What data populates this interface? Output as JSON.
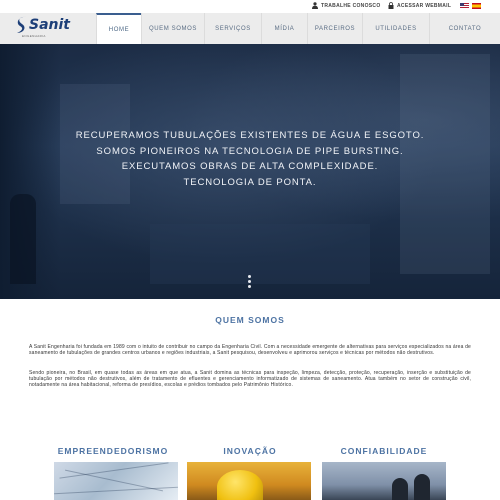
{
  "utility": {
    "work_label": "TRABALHE CONOSCO",
    "webmail_label": "ACESSAR WEBMAIL"
  },
  "header": {
    "logo_text": "Sanit",
    "logo_sub": "ENGENHARIA"
  },
  "nav": {
    "items": [
      "HOME",
      "QUEM SOMOS",
      "SERVIÇOS",
      "MÍDIA",
      "PARCEIROS",
      "UTILIDADES",
      "CONTATO"
    ],
    "active": "HOME"
  },
  "hero": {
    "lines": [
      "RECUPERAMOS TUBULAÇÕES EXISTENTES DE ÁGUA E ESGOTO.",
      "SOMOS PIONEIROS NA TECNOLOGIA DE PIPE BURSTING.",
      "EXECUTAMOS OBRAS DE ALTA COMPLEXIDADE.",
      "TECNOLOGIA DE PONTA."
    ]
  },
  "about": {
    "title": "QUEM SOMOS",
    "paragraph1": "A Sanit Engenharia foi fundada em 1989 com o intuito de contribuir no campo da Engenharia Civil. Com a necessidade emergente de alternativas para serviços especializados na área de saneamento de tubulações de grandes centros urbanos e regiões industriais, a Sanit pesquisou, desenvolveu e aprimorou serviços e técnicas por métodos não destrutivos.",
    "paragraph2": "Sendo pioneira, no Brasil, em quase todas as áreas em que atua, a Sanit domina as técnicas para inspeção, limpeza, detecção, proteção, recuperação, inserção e substituição de tubulação por métodos não destrutivos, além de tratamento de efluentes e gerenciamento informatizado de sistemas de saneamento. Atua também no setor de construção civil, notadamente na área habitacional, reforma de presídios, escolas e prédios tombados pelo Patrimônio Histórico."
  },
  "pillars": {
    "items": [
      "EMPREENDEDORISMO",
      "INOVAÇÃO",
      "CONFIABILIDADE"
    ]
  },
  "colors": {
    "accent": "#4d73a3",
    "brand": "#1d3f78",
    "nav_bg": "#ececec"
  }
}
